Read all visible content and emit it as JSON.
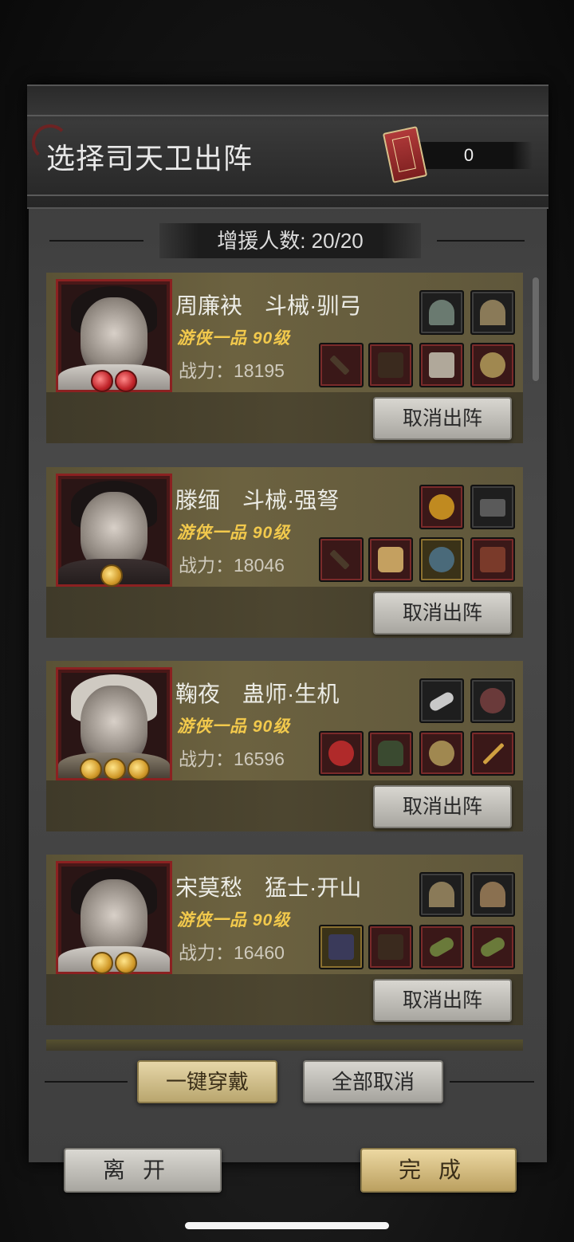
{
  "header": {
    "title": "选择司天卫出阵",
    "token_count": "0"
  },
  "reinforce": {
    "label": "增援人数: 20/20"
  },
  "cards": [
    {
      "name": "周廉袂　斗械·驯弓",
      "rank": "游侠一品 90级",
      "power": "战力：18195",
      "cancel": "取消出阵",
      "badge_color": "red",
      "badge_count": 2
    },
    {
      "name": "滕缅　斗械·强弩",
      "rank": "游侠一品 90级",
      "power": "战力：18046",
      "cancel": "取消出阵",
      "badge_color": "gold",
      "badge_count": 1
    },
    {
      "name": "鞠夜　蛊师·生机",
      "rank": "游侠一品 90级",
      "power": "战力：16596",
      "cancel": "取消出阵",
      "badge_color": "gold",
      "badge_count": 3
    },
    {
      "name": "宋莫愁　猛士·开山",
      "rank": "游侠一品 90级",
      "power": "战力：16460",
      "cancel": "取消出阵",
      "badge_color": "gold",
      "badge_count": 2
    }
  ],
  "actions": {
    "equip_all": "一键穿戴",
    "cancel_all": "全部取消",
    "leave": "离开",
    "done": "完成"
  }
}
